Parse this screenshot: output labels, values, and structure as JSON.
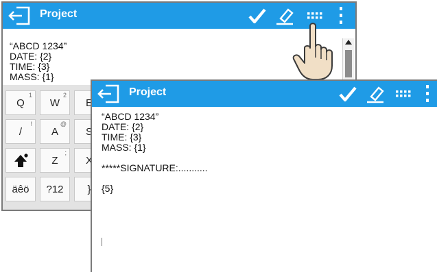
{
  "back_window": {
    "title": "Project",
    "lines": [
      "“ABCD 1234”",
      "DATE: {2}",
      "TIME: {3}",
      "MASS: {1}"
    ],
    "keyboard": [
      {
        "main": "Q",
        "sup": "1"
      },
      {
        "main": "W",
        "sup": "2"
      },
      {
        "main": "E",
        "sup": ""
      },
      {
        "main": "/",
        "sup": "!"
      },
      {
        "main": "A",
        "sup": "@"
      },
      {
        "main": "S",
        "sup": ""
      },
      {
        "main": "Z",
        "sup": ";"
      },
      {
        "main": "X",
        "sup": ""
      },
      {
        "main": "äêö",
        "sup": ""
      },
      {
        "main": "?12",
        "sup": ""
      },
      {
        "main": "}",
        "sup": ""
      }
    ]
  },
  "front_window": {
    "title": "Project",
    "lines": [
      "“ABCD 1234”",
      "DATE: {2}",
      "TIME: {3}",
      "MASS: {1}",
      "",
      "*****SIGNATURE:...........",
      "",
      "{5}"
    ]
  },
  "icons": {
    "back": "back-arrow-icon",
    "confirm": "checkmark-icon",
    "clear": "eraser-icon",
    "keyboard": "keyboard-icon",
    "menu": "more-vertical-icon",
    "shift": "shift-arrow-icon",
    "pointer": "pointing-hand-icon"
  },
  "colors": {
    "titlebar": "#1f9be6",
    "keyboard_bg": "#e3e3e3"
  }
}
